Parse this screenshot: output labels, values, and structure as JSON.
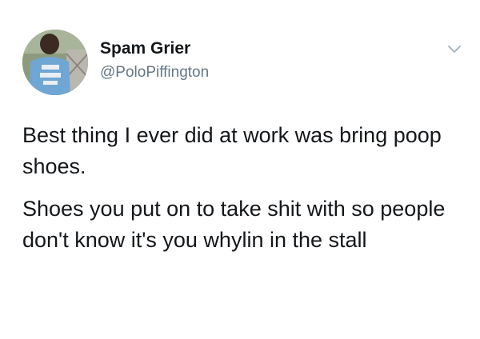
{
  "tweet": {
    "author_name": "Spam Grier",
    "author_handle": "@PoloPiffington",
    "paragraphs": [
      "Best thing I ever did at work was bring poop shoes.",
      "Shoes you put on to take shit with so people don't know it's you whylin in the stall"
    ],
    "icons": {
      "avatar": "profile-photo",
      "menu": "chevron-down-icon"
    },
    "colors": {
      "text": "#14171a",
      "secondary": "#657786",
      "background": "#ffffff"
    }
  }
}
